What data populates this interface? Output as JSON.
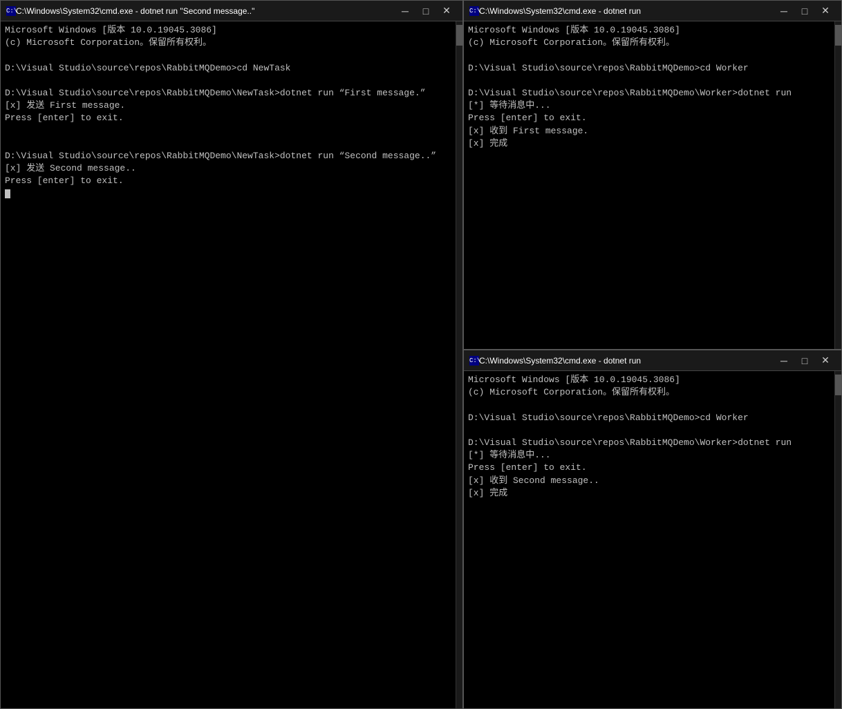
{
  "windows": {
    "left": {
      "title": "C:\\Windows\\System32\\cmd.exe - dotnet  run \"Second message..\"",
      "content_lines": [
        "Microsoft Windows [版本 10.0.19045.3086]",
        "(c) Microsoft Corporation。保留所有权利。",
        "",
        "D:\\Visual Studio\\source\\repos\\RabbitMQDemo>cd NewTask",
        "",
        "D:\\Visual Studio\\source\\repos\\RabbitMQDemo\\NewTask>dotnet run “First message.”",
        "[x] 发送 First message.",
        "Press [enter] to exit.",
        "",
        "",
        "D:\\Visual Studio\\source\\repos\\RabbitMQDemo\\NewTask>dotnet run “Second message..”",
        "[x] 发送 Second message..",
        "Press [enter] to exit.",
        "_"
      ],
      "buttons": {
        "minimize": "─",
        "maximize": "□",
        "close": "✕"
      }
    },
    "right_top": {
      "title": "C:\\Windows\\System32\\cmd.exe - dotnet  run",
      "content_lines": [
        "Microsoft Windows [版本 10.0.19045.3086]",
        "(c) Microsoft Corporation。保留所有权利。",
        "",
        "D:\\Visual Studio\\source\\repos\\RabbitMQDemo>cd Worker",
        "",
        "D:\\Visual Studio\\source\\repos\\RabbitMQDemo\\Worker>dotnet run",
        "[*] 等待消息中...",
        "Press [enter] to exit.",
        "[x] 收到 First message.",
        "[x] 完成"
      ],
      "buttons": {
        "minimize": "─",
        "maximize": "□",
        "close": "✕"
      }
    },
    "right_bottom": {
      "title": "C:\\Windows\\System32\\cmd.exe - dotnet  run",
      "content_lines": [
        "Microsoft Windows [版本 10.0.19045.3086]",
        "(c) Microsoft Corporation。保留所有权利。",
        "",
        "D:\\Visual Studio\\source\\repos\\RabbitMQDemo>cd Worker",
        "",
        "D:\\Visual Studio\\source\\repos\\RabbitMQDemo\\Worker>dotnet run",
        "[*] 等待消息中...",
        "Press [enter] to exit.",
        "[x] 收到 Second message..",
        "[x] 完成"
      ],
      "buttons": {
        "minimize": "─",
        "maximize": "□",
        "close": "✕"
      }
    }
  }
}
